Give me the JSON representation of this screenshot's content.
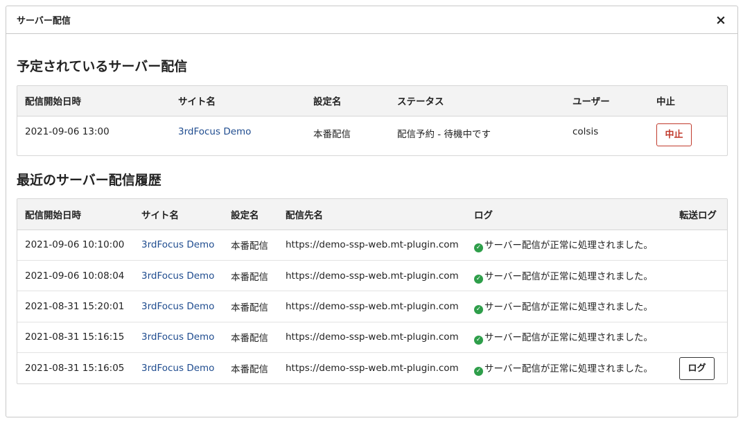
{
  "modal": {
    "title": "サーバー配信",
    "close_icon": "×"
  },
  "scheduled": {
    "title": "予定されているサーバー配信",
    "columns": [
      "配信開始日時",
      "サイト名",
      "設定名",
      "ステータス",
      "ユーザー",
      "中止"
    ],
    "rows": [
      {
        "start": "2021-09-06 13:00",
        "site": "3rdFocus Demo",
        "setting": "本番配信",
        "status": "配信予約 - 待機中です",
        "user": "colsis",
        "abort_label": "中止"
      }
    ]
  },
  "history": {
    "title": "最近のサーバー配信履歴",
    "columns": [
      "配信開始日時",
      "サイト名",
      "設定名",
      "配信先名",
      "ログ",
      "転送ログ"
    ],
    "rows": [
      {
        "start": "2021-09-06 10:10:00",
        "site": "3rdFocus Demo",
        "setting": "本番配信",
        "dest": "https://demo-ssp-web.mt-plugin.com",
        "log": "サーバー配信が正常に処理されました。",
        "transfer_log_label": ""
      },
      {
        "start": "2021-09-06 10:08:04",
        "site": "3rdFocus Demo",
        "setting": "本番配信",
        "dest": "https://demo-ssp-web.mt-plugin.com",
        "log": "サーバー配信が正常に処理されました。",
        "transfer_log_label": ""
      },
      {
        "start": "2021-08-31 15:20:01",
        "site": "3rdFocus Demo",
        "setting": "本番配信",
        "dest": "https://demo-ssp-web.mt-plugin.com",
        "log": "サーバー配信が正常に処理されました。",
        "transfer_log_label": ""
      },
      {
        "start": "2021-08-31 15:16:15",
        "site": "3rdFocus Demo",
        "setting": "本番配信",
        "dest": "https://demo-ssp-web.mt-plugin.com",
        "log": "サーバー配信が正常に処理されました。",
        "transfer_log_label": ""
      },
      {
        "start": "2021-08-31 15:16:05",
        "site": "3rdFocus Demo",
        "setting": "本番配信",
        "dest": "https://demo-ssp-web.mt-plugin.com",
        "log": "サーバー配信が正常に処理されました。",
        "transfer_log_label": "ログ"
      }
    ]
  },
  "icons": {
    "success": "check-circle-icon",
    "close": "close-icon"
  },
  "colors": {
    "link": "#1f4c8f",
    "abort": "#c0392b",
    "success": "#2e9e4a"
  }
}
